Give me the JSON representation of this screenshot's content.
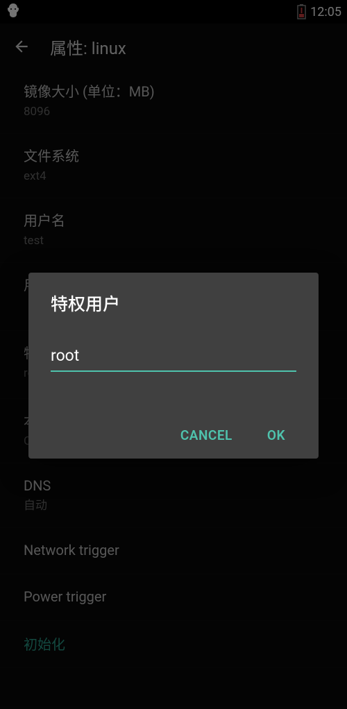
{
  "statusbar": {
    "time": "12:05"
  },
  "appbar": {
    "title": "属性: linux"
  },
  "settings": [
    {
      "title": "镜像大小 (单位：MB)",
      "value": "8096"
    },
    {
      "title": "文件系统",
      "value": "ext4"
    },
    {
      "title": "用户名",
      "value": "test"
    },
    {
      "title": "用户密码",
      "value": ""
    },
    {
      "title": "特权用户",
      "value": "root"
    },
    {
      "title": "本地化",
      "value": "C"
    },
    {
      "title": "DNS",
      "value": "自动"
    },
    {
      "title": "Network trigger",
      "value": ""
    },
    {
      "title": "Power trigger",
      "value": ""
    }
  ],
  "init_link": "初始化",
  "dialog": {
    "title": "特权用户",
    "value": "root",
    "cancel": "CANCEL",
    "ok": "OK"
  }
}
